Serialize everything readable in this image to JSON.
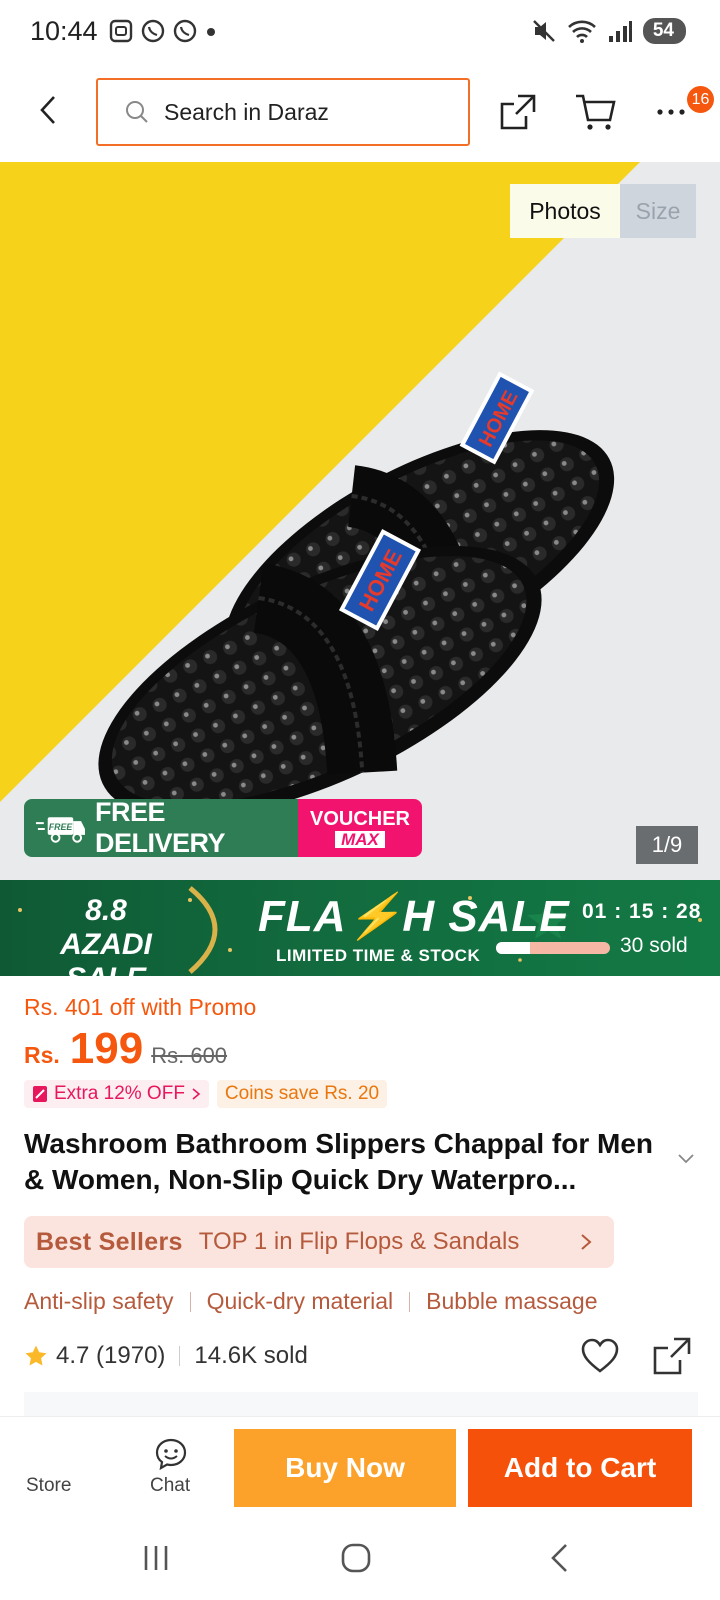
{
  "status_bar": {
    "time": "10:44",
    "battery": "54"
  },
  "search": {
    "placeholder": "Search in Daraz"
  },
  "top_bar": {
    "more_badge": "16"
  },
  "gallery": {
    "tabs": [
      "Photos",
      "Size"
    ],
    "counter": "1/9",
    "free_delivery": "FREE DELIVERY",
    "voucher": "VOUCHER",
    "voucher_max": "MAX",
    "free_tag": "FREE",
    "sole_badge_text": "HOME"
  },
  "flash_sale": {
    "event_line1": "8.8 AZADI",
    "event_line2": "SALE",
    "title": "FLA⚡H SALE",
    "subtitle": "LIMITED TIME & STOCK",
    "timer": "01 : 15 : 28",
    "sold": "30 sold",
    "progress_fraction": 0.3
  },
  "product": {
    "promo_off": "Rs. 401 off with Promo",
    "currency": "Rs.",
    "price": "199",
    "old_price": "Rs. 600",
    "extra_off": "Extra 12% OFF",
    "coins_save": "Coins save Rs. 20",
    "title": "Washroom Bathroom Slippers Chappal for Men & Women, Non-Slip Quick Dry Waterpro...",
    "best_sellers_label": "Best Sellers",
    "best_sellers_text": "TOP 1 in Flip Flops & Sandals",
    "features": [
      "Anti-slip safety",
      "Quick-dry material",
      "Bubble massage"
    ],
    "rating": "4.7 (1970)",
    "sold": "14.6K sold"
  },
  "bottom_bar": {
    "store": "Store",
    "chat": "Chat",
    "buy_now": "Buy Now",
    "add_to_cart": "Add to Cart"
  },
  "colors": {
    "accent_orange": "#f5570e",
    "buy_now": "#fca22b",
    "flash_green": "#126b3e",
    "voucher_pink": "#f2136e",
    "free_delivery_green": "#2e7d54",
    "hero_yellow": "#f6d21a"
  }
}
